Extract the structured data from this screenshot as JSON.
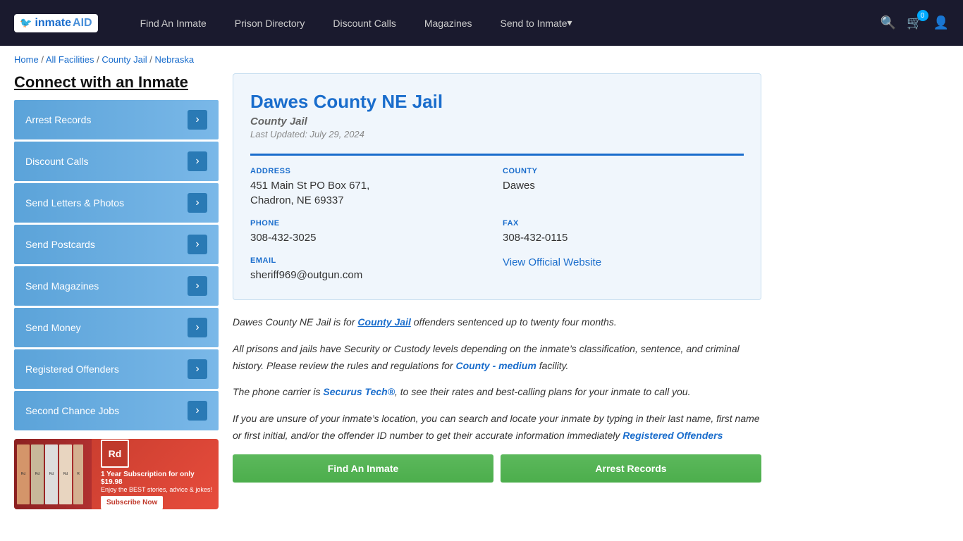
{
  "navbar": {
    "logo_inmate": "inmate",
    "logo_aid": "AID",
    "links": [
      {
        "label": "Find An Inmate",
        "has_arrow": false
      },
      {
        "label": "Prison Directory",
        "has_arrow": false
      },
      {
        "label": "Discount Calls",
        "has_arrow": false
      },
      {
        "label": "Magazines",
        "has_arrow": false
      },
      {
        "label": "Send to Inmate",
        "has_arrow": true
      }
    ],
    "cart_count": "0"
  },
  "breadcrumb": {
    "items": [
      "Home",
      "All Facilities",
      "County Jail",
      "Nebraska"
    ],
    "separators": [
      "/",
      "/",
      "/"
    ]
  },
  "sidebar": {
    "title": "Connect with an Inmate",
    "menu_items": [
      "Arrest Records",
      "Discount Calls",
      "Send Letters & Photos",
      "Send Postcards",
      "Send Magazines",
      "Send Money",
      "Registered Offenders",
      "Second Chance Jobs"
    ]
  },
  "facility": {
    "name": "Dawes County NE Jail",
    "type": "County Jail",
    "last_updated": "Last Updated: July 29, 2024",
    "address_label": "ADDRESS",
    "address_line1": "451 Main St PO Box 671,",
    "address_line2": "Chadron, NE 69337",
    "county_label": "COUNTY",
    "county_value": "Dawes",
    "phone_label": "PHONE",
    "phone_value": "308-432-3025",
    "fax_label": "FAX",
    "fax_value": "308-432-0115",
    "email_label": "EMAIL",
    "email_value": "sheriff969@outgun.com",
    "website_label": "View Official Website"
  },
  "description": {
    "para1_before": "Dawes County NE Jail is for ",
    "para1_bold": "County Jail",
    "para1_after": " offenders sentenced up to twenty four months.",
    "para2": "All prisons and jails have Security or Custody levels depending on the inmate’s classification, sentence, and criminal history. Please review the rules and regulations for ",
    "para2_bold": "County - medium",
    "para2_after": " facility.",
    "para3_before": "The phone carrier is ",
    "para3_bold": "Securus Tech®",
    "para3_after": ", to see their rates and best-calling plans for your inmate to call you.",
    "para4_before": "If you are unsure of your inmate’s location, you can search and locate your inmate by typing in their last name, first name or first initial, and/or the offender ID number to get their accurate information immediately ",
    "para4_bold": "Registered Offenders",
    "action_btn1": "Find An Inmate",
    "action_btn2": "Arrest Records"
  },
  "ad": {
    "logo": "Rd",
    "title": "1 Year Subscription for only $19.98",
    "subtitle": "Enjoy the BEST stories, advice & jokes!",
    "subscribe_btn": "Subscribe Now",
    "mag_label": "Reader's Digest"
  }
}
